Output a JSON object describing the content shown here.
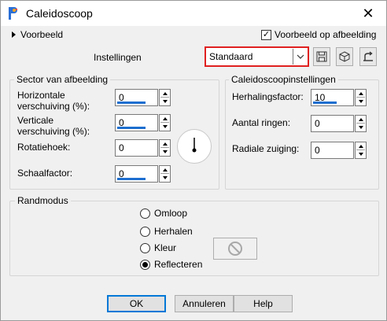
{
  "window": {
    "title": "Caleidoscoop",
    "close_glyph": "✕"
  },
  "preview": {
    "toggle_label": "Voorbeeld",
    "checkbox_label": "Voorbeeld op afbeelding",
    "checked": true,
    "check_glyph": "✓"
  },
  "settings": {
    "label": "Instellingen",
    "preset_value": "Standaard"
  },
  "sector": {
    "title": "Sector van afbeelding",
    "horizontal_label": "Horizontale verschuiving (%):",
    "horizontal_value": "0",
    "vertical_label": "Verticale verschuiving (%):",
    "vertical_value": "0",
    "rotation_label": "Rotatiehoek:",
    "rotation_value": "0",
    "scale_label": "Schaalfactor:",
    "scale_value": "0"
  },
  "kaleidoscope": {
    "title": "Caleidoscoopinstellingen",
    "repeat_label": "Herhalingsfactor:",
    "repeat_value": "10",
    "rings_label": "Aantal ringen:",
    "rings_value": "0",
    "radial_label": "Radiale zuiging:",
    "radial_value": "0"
  },
  "edge_mode": {
    "title": "Randmodus",
    "options": [
      {
        "label": "Omloop",
        "selected": false
      },
      {
        "label": "Herhalen",
        "selected": false
      },
      {
        "label": "Kleur",
        "selected": false
      },
      {
        "label": "Reflecteren",
        "selected": true
      }
    ]
  },
  "buttons": {
    "ok": "OK",
    "cancel": "Annuleren",
    "help": "Help"
  },
  "colors": {
    "accent": "#1e6fd0",
    "highlight_border": "#e02020",
    "default_button": "#0078d7"
  },
  "icons": [
    "app-icon",
    "close-icon",
    "expand-triangle-icon",
    "save-preset-icon",
    "cube-icon",
    "reset-icon",
    "no-color-icon"
  ]
}
